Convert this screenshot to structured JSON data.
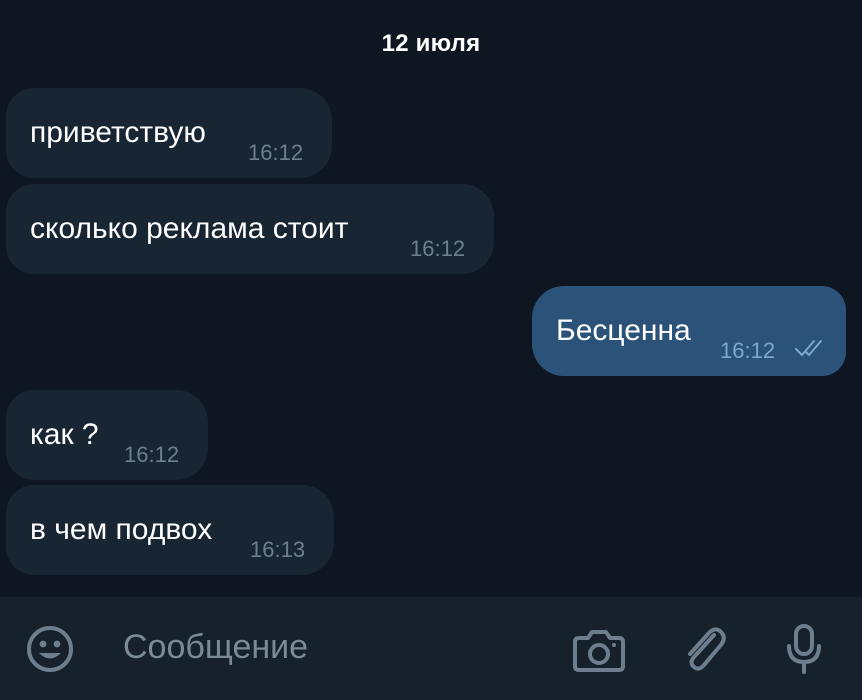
{
  "chat": {
    "date_separator": "12 июля",
    "messages": [
      {
        "direction": "incoming",
        "text": "приветствую",
        "time": "16:12"
      },
      {
        "direction": "incoming",
        "text": "сколько реклама стоит",
        "time": "16:12"
      },
      {
        "direction": "outgoing",
        "text": "Бесценна",
        "time": "16:12",
        "status": "read"
      },
      {
        "direction": "incoming",
        "text": "как ?",
        "time": "16:12"
      },
      {
        "direction": "incoming",
        "text": "в чем подвох",
        "time": "16:13"
      }
    ]
  },
  "composer": {
    "placeholder": "Сообщение",
    "icons": [
      "emoji-icon",
      "camera-icon",
      "paperclip-icon",
      "microphone-icon"
    ]
  },
  "colors": {
    "chat_background": "#0e1621",
    "incoming_bubble": "#182533",
    "outgoing_bubble": "#2b5278",
    "composer_background": "#17212b",
    "icon_color": "#6d7f8f",
    "read_ticks": "#7da7cf"
  }
}
